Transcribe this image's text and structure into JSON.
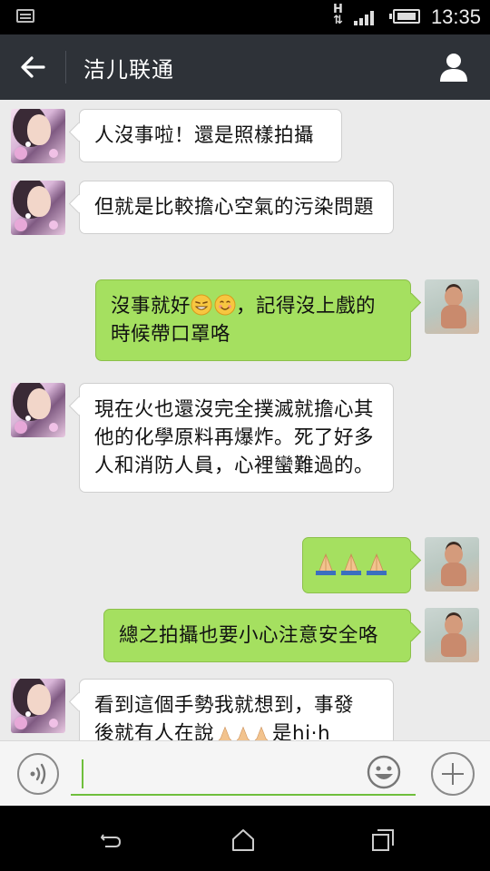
{
  "status_bar": {
    "network": "H",
    "time": "13:35"
  },
  "header": {
    "title": "洁儿联通"
  },
  "messages": [
    {
      "side": "in",
      "text": "人沒事啦！還是照樣拍攝"
    },
    {
      "side": "in",
      "text": "但就是比較擔心空氣的污染問題"
    },
    {
      "side": "out",
      "text_before": "沒事就好",
      "emojis": [
        "grin-icon",
        "smile-icon"
      ],
      "text_after": "，記得沒上戲的時候帶口罩咯"
    },
    {
      "side": "in",
      "text": "現在火也還沒完全撲滅就擔心其他的化學原料再爆炸。死了好多人和消防人員，心裡蠻難過的。"
    },
    {
      "side": "out",
      "emojis": [
        "pray-icon",
        "pray-icon",
        "pray-icon"
      ]
    },
    {
      "side": "out",
      "text": "總之拍攝也要小心注意安全咯"
    },
    {
      "side": "in",
      "text": "看到這個手勢我就想到，事發",
      "partial_second_line": "後就有人在說",
      "partial_tail": "是hi·h"
    }
  ],
  "input": {
    "value": "",
    "placeholder": ""
  },
  "colors": {
    "header_bg": "#2e3238",
    "chat_bg": "#ebebeb",
    "outgoing_bubble": "#a5e060",
    "incoming_bubble": "#ffffff",
    "accent": "#6fbf3c"
  }
}
